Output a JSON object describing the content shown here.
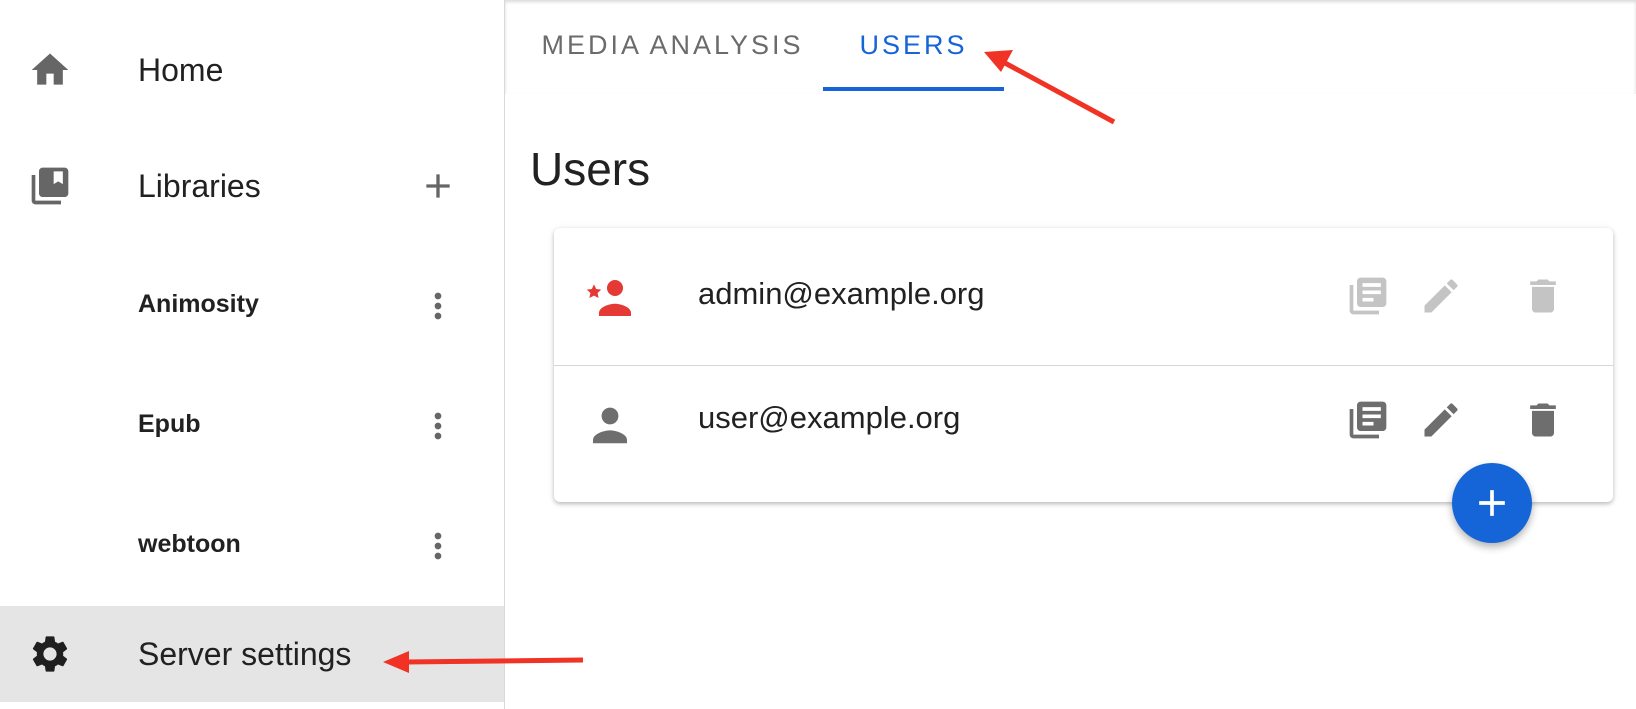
{
  "sidebar": {
    "home": {
      "label": "Home",
      "icon": "home-icon"
    },
    "libraries": {
      "label": "Libraries",
      "icon": "libraries-icon",
      "add_icon": "plus-icon",
      "items": [
        {
          "label": "Animosity",
          "menu_icon": "more-vert-icon"
        },
        {
          "label": "Epub",
          "menu_icon": "more-vert-icon"
        },
        {
          "label": "webtoon",
          "menu_icon": "more-vert-icon"
        }
      ]
    },
    "server_settings": {
      "label": "Server settings",
      "icon": "gear-icon",
      "active": true
    }
  },
  "tabs": [
    {
      "label": "MEDIA ANALYSIS",
      "active": false
    },
    {
      "label": "USERS",
      "active": true
    }
  ],
  "main": {
    "title": "Users",
    "users": [
      {
        "email": "admin@example.org",
        "role_icon": "admin-user-icon",
        "actions_enabled": false
      },
      {
        "email": "user@example.org",
        "role_icon": "user-icon",
        "actions_enabled": true
      }
    ],
    "row_actions": [
      "library-access-icon",
      "edit-icon",
      "delete-icon"
    ],
    "fab_icon": "plus-icon"
  },
  "colors": {
    "accent": "#1565d8",
    "admin_icon": "#e53935",
    "annotation_arrow": "#f03324",
    "active_nav_bg": "#e5e5e5"
  }
}
